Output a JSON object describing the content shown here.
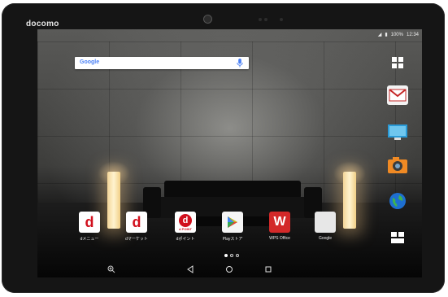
{
  "device": {
    "brand": "docomo"
  },
  "status_bar": {
    "battery": "100%",
    "time": "12:34"
  },
  "search": {
    "logo": "Google"
  },
  "side_icons": [
    {
      "name": "app-drawer-icon"
    },
    {
      "name": "mail-icon"
    },
    {
      "name": "monitor-icon"
    },
    {
      "name": "camera-icon"
    },
    {
      "name": "globe-icon"
    },
    {
      "name": "widget-icon"
    }
  ],
  "apps": [
    {
      "label": "dメニュー",
      "color": "#ffffff"
    },
    {
      "label": "dマーケット",
      "color": "#ffffff"
    },
    {
      "label": "dポイント",
      "color": "#d1101d",
      "badge": "d POINT"
    },
    {
      "label": "Playストア",
      "color": "#ffffff"
    },
    {
      "label": "WPS Office",
      "color": "#d32929"
    },
    {
      "label": "Google",
      "color": "#e7e7e7"
    }
  ],
  "page_indicator": {
    "count": 3,
    "active": 1
  },
  "colors": {
    "docomo_red": "#d1101d",
    "google_blue": "#4a80f5"
  }
}
